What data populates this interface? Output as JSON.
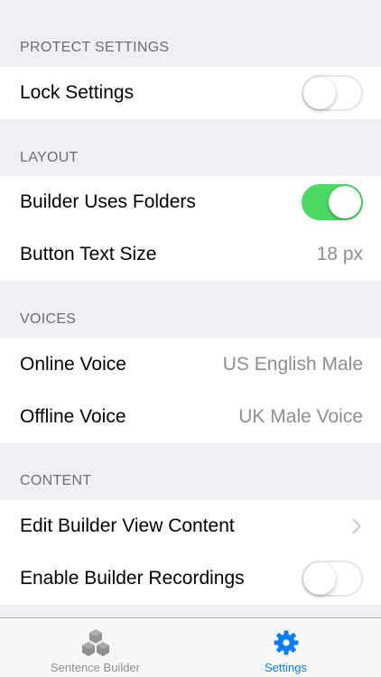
{
  "colors": {
    "background": "#efeff4",
    "accent": "#0a7cf9",
    "switch_on": "#4cd964",
    "secondary_text": "#8e8e93",
    "section_header": "#6d6d72",
    "tab_inactive": "#8e8e93"
  },
  "sections": {
    "protect": {
      "header": "PROTECT SETTINGS",
      "lock_settings": {
        "label": "Lock Settings",
        "on": false
      }
    },
    "layout": {
      "header": "LAYOUT",
      "builder_uses_folders": {
        "label": "Builder Uses Folders",
        "on": true
      },
      "button_text_size": {
        "label": "Button Text Size",
        "value": "18 px"
      }
    },
    "voices": {
      "header": "VOICES",
      "online_voice": {
        "label": "Online Voice",
        "value": "US English Male"
      },
      "offline_voice": {
        "label": "Offline Voice",
        "value": "UK Male Voice"
      }
    },
    "content": {
      "header": "CONTENT",
      "edit_builder_view": {
        "label": "Edit Builder View Content",
        "icon": "chevron-right-icon"
      },
      "enable_recordings": {
        "label": "Enable Builder Recordings",
        "on": false
      }
    }
  },
  "tabbar": {
    "tabs": [
      {
        "label": "Sentence Builder",
        "icon": "cubes-icon",
        "selected": false
      },
      {
        "label": "Settings",
        "icon": "gear-icon",
        "selected": true
      }
    ]
  }
}
